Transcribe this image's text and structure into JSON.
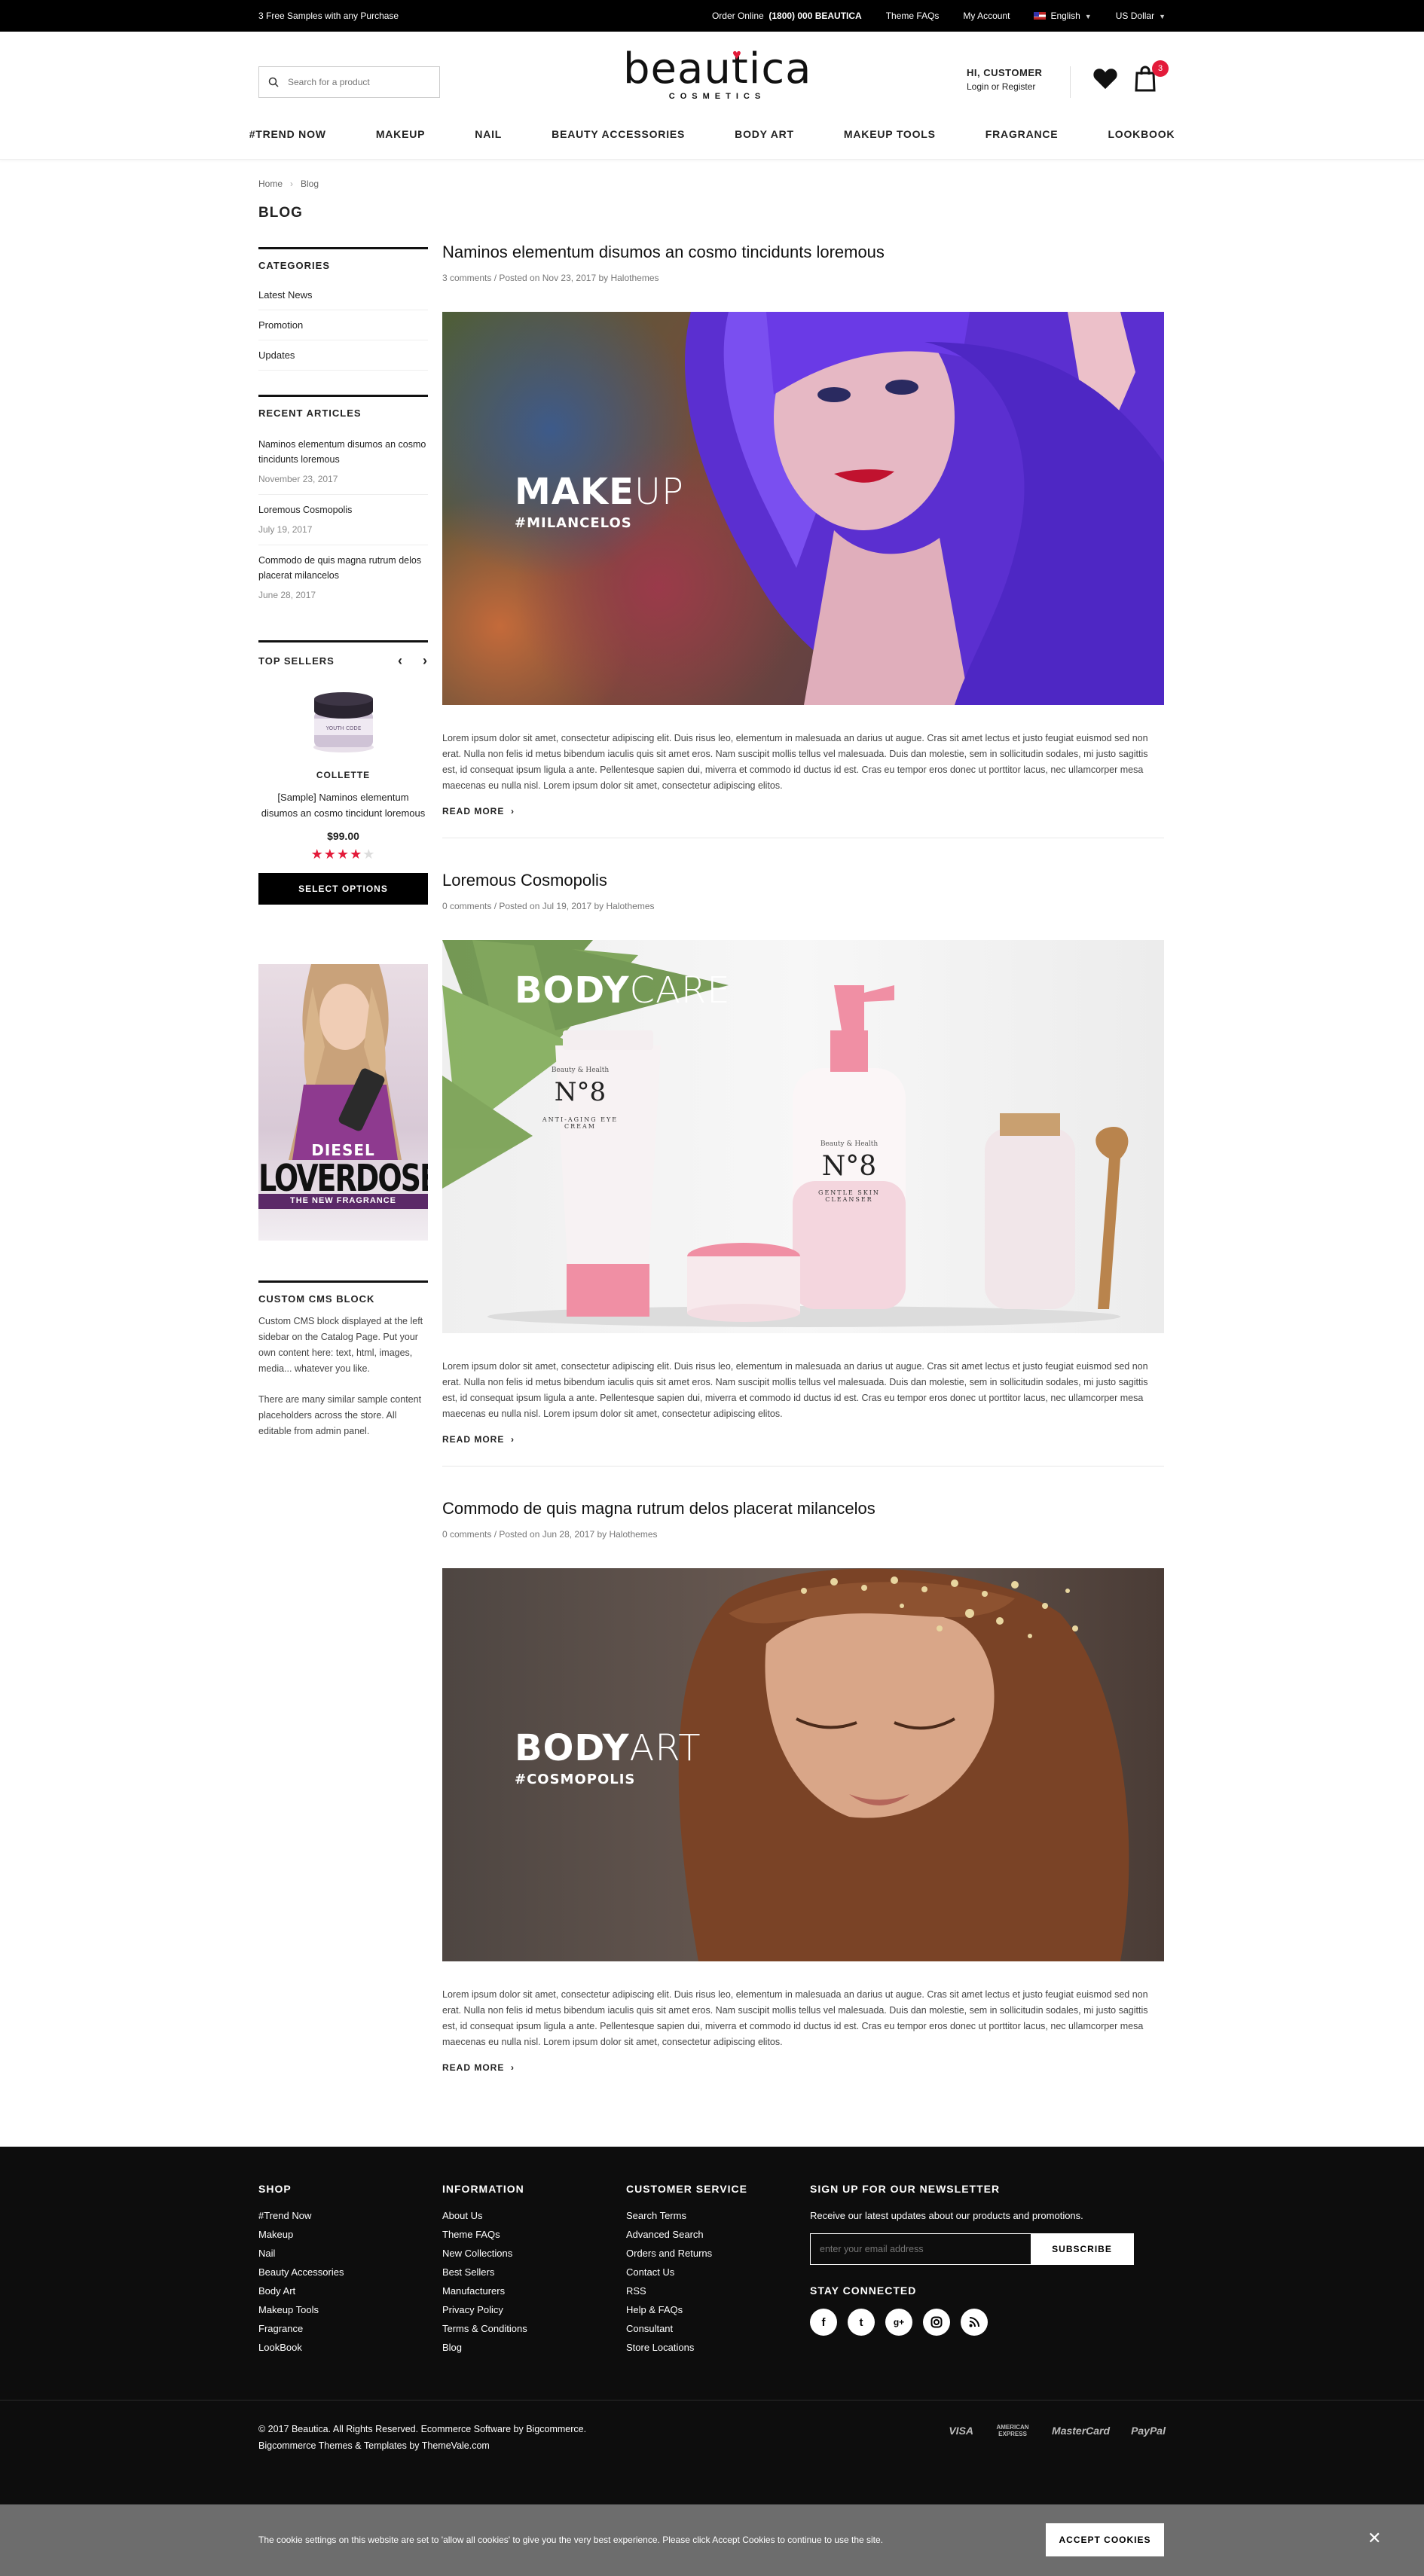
{
  "topbar": {
    "promo": "3 Free Samples with any Purchase",
    "order_label": "Order Online",
    "order_phone": "(1800) 000 BEAUTICA",
    "faq": "Theme FAQs",
    "account": "My Account",
    "language": "English",
    "currency": "US Dollar"
  },
  "header": {
    "search_placeholder": "Search for a product",
    "logo": "beautica",
    "logo_sub": "COSMETICS",
    "greeting": "HI, CUSTOMER",
    "login": "Login",
    "or": "or",
    "register": "Register",
    "cart_count": "3"
  },
  "nav": [
    "#TREND NOW",
    "MAKEUP",
    "NAIL",
    "BEAUTY ACCESSORIES",
    "BODY ART",
    "MAKEUP TOOLS",
    "FRAGRANCE",
    "LOOKBOOK"
  ],
  "breadcrumb": {
    "home": "Home",
    "current": "Blog"
  },
  "page_title": "BLOG",
  "sidebar": {
    "categories_title": "CATEGORIES",
    "categories": [
      "Latest News",
      "Promotion",
      "Updates"
    ],
    "recent_title": "RECENT ARTICLES",
    "recent": [
      {
        "title": "Naminos elementum disumos an cosmo tincidunts loremous",
        "date": "November 23, 2017"
      },
      {
        "title": "Loremous Cosmopolis",
        "date": "July 19, 2017"
      },
      {
        "title": "Commodo de quis magna rutrum delos placerat milancelos",
        "date": "June 28, 2017"
      }
    ],
    "top_sellers_title": "TOP SELLERS",
    "product": {
      "brand": "COLLETTE",
      "name": "[Sample] Naminos elementum disumos an cosmo tincidunt loremous",
      "price": "$99.00",
      "rating": 4,
      "button": "SELECT OPTIONS",
      "jar_label": "YOUTH CODE"
    },
    "ad": {
      "brand": "DIESEL",
      "title": "LOVERDOSE",
      "sub": "THE NEW FRAGRANCE"
    },
    "cms_title": "CUSTOM CMS BLOCK",
    "cms_p1": "Custom CMS block displayed at the left sidebar on the Catalog Page. Put your own content here: text, html, images, media... whatever you like.",
    "cms_p2": "There are many similar sample content placeholders across the store. All editable from admin panel."
  },
  "posts": [
    {
      "title": "Naminos elementum disumos an cosmo tincidunts loremous",
      "meta": "3 comments / Posted on Nov 23, 2017 by Halothemes",
      "cap_bold": "MAKE",
      "cap_light": "UP",
      "tag": "#MILANCELOS",
      "excerpt": "Lorem ipsum dolor sit amet, consectetur adipiscing elit. Duis risus leo, elementum in malesuada an darius ut augue. Cras sit amet lectus et justo feugiat euismod sed non erat. Nulla non felis id metus bibendum iaculis quis sit amet eros. Nam suscipit mollis tellus vel malesuada. Duis dan molestie, sem in sollicitudin sodales, mi justo sagittis est, id consequat ipsum ligula a ante. Pellentesque sapien dui, miverra et commodo id ductus id est. Cras eu tempor eros donec ut porttitor lacus, nec ullamcorper mesa maecenas eu nulla nisl. Lorem ipsum dolor sit amet, consectetur adipiscing elitos.",
      "read_more": "READ MORE"
    },
    {
      "title": "Loremous Cosmopolis",
      "meta": "0 comments / Posted on Jul 19, 2017 by Halothemes",
      "cap_bold": "BODY",
      "cap_light": "CARE",
      "tag": "",
      "product_brand": "Beauty & Health",
      "product_no": "N°8",
      "p1": "ANTI-AGING EYE CREAM",
      "p2": "GENTLE SKIN CLEANSER",
      "excerpt": "Lorem ipsum dolor sit amet, consectetur adipiscing elit. Duis risus leo, elementum in malesuada an darius ut augue. Cras sit amet lectus et justo feugiat euismod sed non erat. Nulla non felis id metus bibendum iaculis quis sit amet eros. Nam suscipit mollis tellus vel malesuada. Duis dan molestie, sem in sollicitudin sodales, mi justo sagittis est, id consequat ipsum ligula a ante. Pellentesque sapien dui, miverra et commodo id ductus id est. Cras eu tempor eros donec ut porttitor lacus, nec ullamcorper mesa maecenas eu nulla nisl. Lorem ipsum dolor sit amet, consectetur adipiscing elitos.",
      "read_more": "READ MORE"
    },
    {
      "title": "Commodo de quis magna rutrum delos placerat milancelos",
      "meta": "0 comments / Posted on Jun 28, 2017 by Halothemes",
      "cap_bold": "BODY",
      "cap_light": "ART",
      "tag": "#COSMOPOLIS",
      "excerpt": "Lorem ipsum dolor sit amet, consectetur adipiscing elit. Duis risus leo, elementum in malesuada an darius ut augue. Cras sit amet lectus et justo feugiat euismod sed non erat. Nulla non felis id metus bibendum iaculis quis sit amet eros. Nam suscipit mollis tellus vel malesuada. Duis dan molestie, sem in sollicitudin sodales, mi justo sagittis est, id consequat ipsum ligula a ante. Pellentesque sapien dui, miverra et commodo id ductus id est. Cras eu tempor eros donec ut porttitor lacus, nec ullamcorper mesa maecenas eu nulla nisl. Lorem ipsum dolor sit amet, consectetur adipiscing elitos.",
      "read_more": "READ MORE"
    }
  ],
  "footer": {
    "shop_title": "SHOP",
    "shop": [
      "#Trend Now",
      "Makeup",
      "Nail",
      "Beauty Accessories",
      "Body Art",
      "Makeup Tools",
      "Fragrance",
      "LookBook"
    ],
    "info_title": "INFORMATION",
    "info": [
      "About Us",
      "Theme FAQs",
      "New Collections",
      "Best Sellers",
      "Manufacturers",
      "Privacy Policy",
      "Terms & Conditions",
      "Blog"
    ],
    "service_title": "CUSTOMER SERVICE",
    "service": [
      "Search Terms",
      "Advanced Search",
      "Orders and Returns",
      "Contact Us",
      "RSS",
      "Help & FAQs",
      "Consultant",
      "Store Locations"
    ],
    "newsletter_title": "SIGN UP FOR OUR NEWSLETTER",
    "newsletter_text": "Receive our latest updates about our products and promotions.",
    "email_placeholder": "enter your email address",
    "subscribe": "SUBSCRIBE",
    "stay_connected": "STAY CONNECTED",
    "copyright": "© 2017 Beautica. All Rights Reserved. Ecommerce Software by Bigcommerce.",
    "credits": "Bigcommerce Themes & Templates by ThemeVale.com",
    "payments": [
      "VISA",
      "AMERICAN EXPRESS",
      "MasterCard",
      "PayPal"
    ]
  },
  "cookie": {
    "text": "The cookie settings on this website are set to 'allow all cookies' to give you the very best experience. Please click Accept Cookies to continue to use the site.",
    "accept": "ACCEPT COOKIES",
    "close": "✕"
  },
  "colors": {
    "accent": "#e31b3a",
    "dark": "#0d0d0d",
    "cookie_bar": "#6d6d6d"
  }
}
